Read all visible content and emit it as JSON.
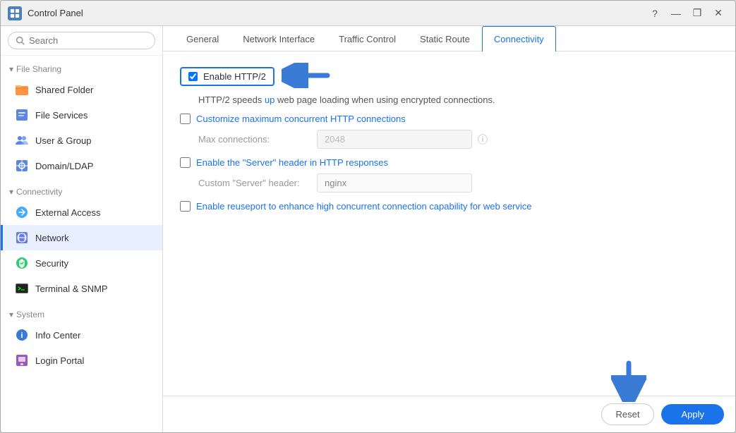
{
  "window": {
    "title": "Control Panel",
    "icon": "control-panel-icon"
  },
  "titlebar": {
    "buttons": {
      "help": "?",
      "minimize": "—",
      "maximize": "❐",
      "close": "✕"
    }
  },
  "sidebar": {
    "search_placeholder": "Search",
    "sections": [
      {
        "id": "file-sharing",
        "label": "File Sharing",
        "expanded": true,
        "items": [
          {
            "id": "shared-folder",
            "label": "Shared Folder",
            "icon": "folder-icon"
          },
          {
            "id": "file-services",
            "label": "File Services",
            "icon": "file-services-icon"
          },
          {
            "id": "user-group",
            "label": "User & Group",
            "icon": "user-group-icon"
          },
          {
            "id": "domain-ldap",
            "label": "Domain/LDAP",
            "icon": "domain-icon"
          }
        ]
      },
      {
        "id": "connectivity",
        "label": "Connectivity",
        "expanded": true,
        "items": [
          {
            "id": "external-access",
            "label": "External Access",
            "icon": "external-access-icon"
          },
          {
            "id": "network",
            "label": "Network",
            "icon": "network-icon",
            "active": true
          },
          {
            "id": "security",
            "label": "Security",
            "icon": "security-icon"
          },
          {
            "id": "terminal-snmp",
            "label": "Terminal & SNMP",
            "icon": "terminal-icon"
          }
        ]
      },
      {
        "id": "system",
        "label": "System",
        "expanded": true,
        "items": [
          {
            "id": "info-center",
            "label": "Info Center",
            "icon": "info-icon"
          },
          {
            "id": "login-portal",
            "label": "Login Portal",
            "icon": "login-icon"
          }
        ]
      }
    ]
  },
  "tabs": [
    {
      "id": "general",
      "label": "General"
    },
    {
      "id": "network-interface",
      "label": "Network Interface"
    },
    {
      "id": "traffic-control",
      "label": "Traffic Control"
    },
    {
      "id": "static-route",
      "label": "Static Route"
    },
    {
      "id": "connectivity",
      "label": "Connectivity",
      "active": true
    }
  ],
  "content": {
    "enable_http2": {
      "label": "Enable HTTP/2",
      "checked": true,
      "description_prefix": "HTTP/2 speeds ",
      "description_link": "up",
      "description_suffix": " web page loading when using encrypted connections."
    },
    "customize_connections": {
      "label": "Customize maximum concurrent HTTP connections",
      "checked": false
    },
    "max_connections": {
      "label": "Max connections:",
      "value": "2048",
      "placeholder": "2048"
    },
    "enable_server_header": {
      "label": "Enable the \"Server\" header in HTTP responses",
      "checked": false
    },
    "custom_server_header": {
      "label": "Custom \"Server\" header:",
      "value": "nginx",
      "placeholder": "nginx"
    },
    "enable_reuseport": {
      "label": "Enable reuseport to enhance high concurrent connection capability for web service",
      "checked": false
    }
  },
  "bottom_bar": {
    "reset_label": "Reset",
    "apply_label": "Apply"
  },
  "colors": {
    "active_tab": "#1a73e8",
    "link_color": "#1a73e8",
    "apply_bg": "#1a73e8",
    "active_sidebar_bg": "#e8f0ff",
    "active_sidebar_border": "#1a73e8"
  }
}
